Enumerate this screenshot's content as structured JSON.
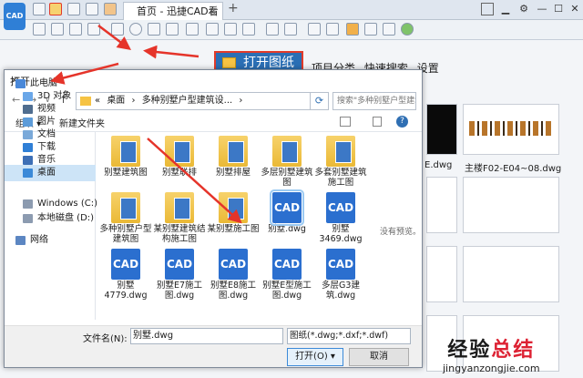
{
  "app": {
    "logo_text": "CAD",
    "tab_title": "首页 - 迅捷CAD看图",
    "tab_close": "×",
    "tab_add": "+"
  },
  "main": {
    "open_button": "打开图纸",
    "menu": [
      "项目分类",
      "快速搜索",
      "设置"
    ],
    "thumbnails": [
      {
        "label": "E.dwg"
      },
      {
        "label": "主楼F02-E04~08.dwg"
      }
    ]
  },
  "dialog": {
    "title": "打开",
    "close": "×",
    "breadcrumb": [
      "«",
      "桌面",
      "›",
      "多种别墅户型建筑设...",
      "›"
    ],
    "search_placeholder": "搜索\"多种别墅户型建筑设计C...",
    "organize": "组织 ▾",
    "new_folder": "新建文件夹",
    "nav": [
      {
        "label": "此电脑",
        "color": "#4a88d8"
      },
      {
        "label": "3D 对象",
        "color": "#6aa7e8"
      },
      {
        "label": "视频",
        "color": "#4f6d8f"
      },
      {
        "label": "图片",
        "color": "#5d9cd9"
      },
      {
        "label": "文档",
        "color": "#7aa9d9"
      },
      {
        "label": "下载",
        "color": "#2f7fd6"
      },
      {
        "label": "音乐",
        "color": "#3d6fb6"
      },
      {
        "label": "桌面",
        "color": "#3c8ad8"
      },
      {
        "label": "Windows (C:)",
        "color": "#8c9bb0"
      },
      {
        "label": "本地磁盘 (D:)",
        "color": "#8c9bb0"
      },
      {
        "label": "网络",
        "color": "#5c86c2"
      }
    ],
    "files": [
      {
        "name": "别墅建筑图",
        "type": "folder"
      },
      {
        "name": "别墅联排",
        "type": "folder"
      },
      {
        "name": "别墅排屋",
        "type": "folder"
      },
      {
        "name": "多层别墅建筑图",
        "type": "folder"
      },
      {
        "name": "多套别墅建筑施工图",
        "type": "folder"
      },
      {
        "name": "多种别墅户型建筑图",
        "type": "folder"
      },
      {
        "name": "某别墅建筑结构施工图",
        "type": "folder"
      },
      {
        "name": "某别墅施工图",
        "type": "folder"
      },
      {
        "name": "别墅.dwg",
        "type": "cad",
        "selected": true
      },
      {
        "name": "别墅3469.dwg",
        "type": "cad"
      },
      {
        "name": "别墅4779.dwg",
        "type": "cad"
      },
      {
        "name": "别墅E7施工图.dwg",
        "type": "cad"
      },
      {
        "name": "别墅E8施工图.dwg",
        "type": "cad"
      },
      {
        "name": "别墅E型施工图.dwg",
        "type": "cad"
      },
      {
        "name": "多层G3建筑.dwg",
        "type": "cad"
      }
    ],
    "cad_icon_text": "CAD",
    "preview_text": "没有预览。",
    "filename_label": "文件名(N):",
    "filename_value": "别墅.dwg",
    "filetype_value": "图纸(*.dwg;*.dxf;*.dwf)",
    "open_label": "打开(O) ▾",
    "cancel_label": "取消"
  },
  "watermark": {
    "line1_a": "经验",
    "line1_b": "总结",
    "line2": "jingyanzongjie.com"
  },
  "colors": {
    "accent": "#2b6fb5",
    "highlight": "#e23b2a",
    "arrow": "#e5342a"
  }
}
